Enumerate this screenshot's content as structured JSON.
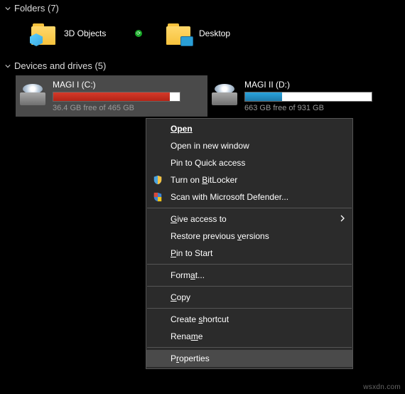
{
  "sections": {
    "folders": {
      "title": "Folders",
      "count": "(7)"
    },
    "drives": {
      "title": "Devices and drives",
      "count": "(5)"
    }
  },
  "folders": {
    "items": [
      {
        "label": "3D Objects"
      },
      {
        "label": "Desktop"
      }
    ]
  },
  "drives": [
    {
      "name": "MAGI I (C:)",
      "free": "36.4 GB free of 465 GB",
      "fill_pct": 92,
      "color": "red",
      "selected": true
    },
    {
      "name": "MAGI II (D:)",
      "free": "663 GB free of 931 GB",
      "fill_pct": 29,
      "color": "blue",
      "selected": false
    }
  ],
  "context_menu": {
    "open": "Open",
    "open_new": "Open in new window",
    "pin_quick": "Pin to Quick access",
    "bitlocker": "Turn on BitLocker",
    "defender": "Scan with Microsoft Defender...",
    "give_access": "Give access to",
    "restore": "Restore previous versions",
    "pin_start": "Pin to Start",
    "format": "Format...",
    "copy": "Copy",
    "shortcut": "Create shortcut",
    "rename": "Rename",
    "properties": "Properties"
  },
  "watermark": "wsxdn.com"
}
